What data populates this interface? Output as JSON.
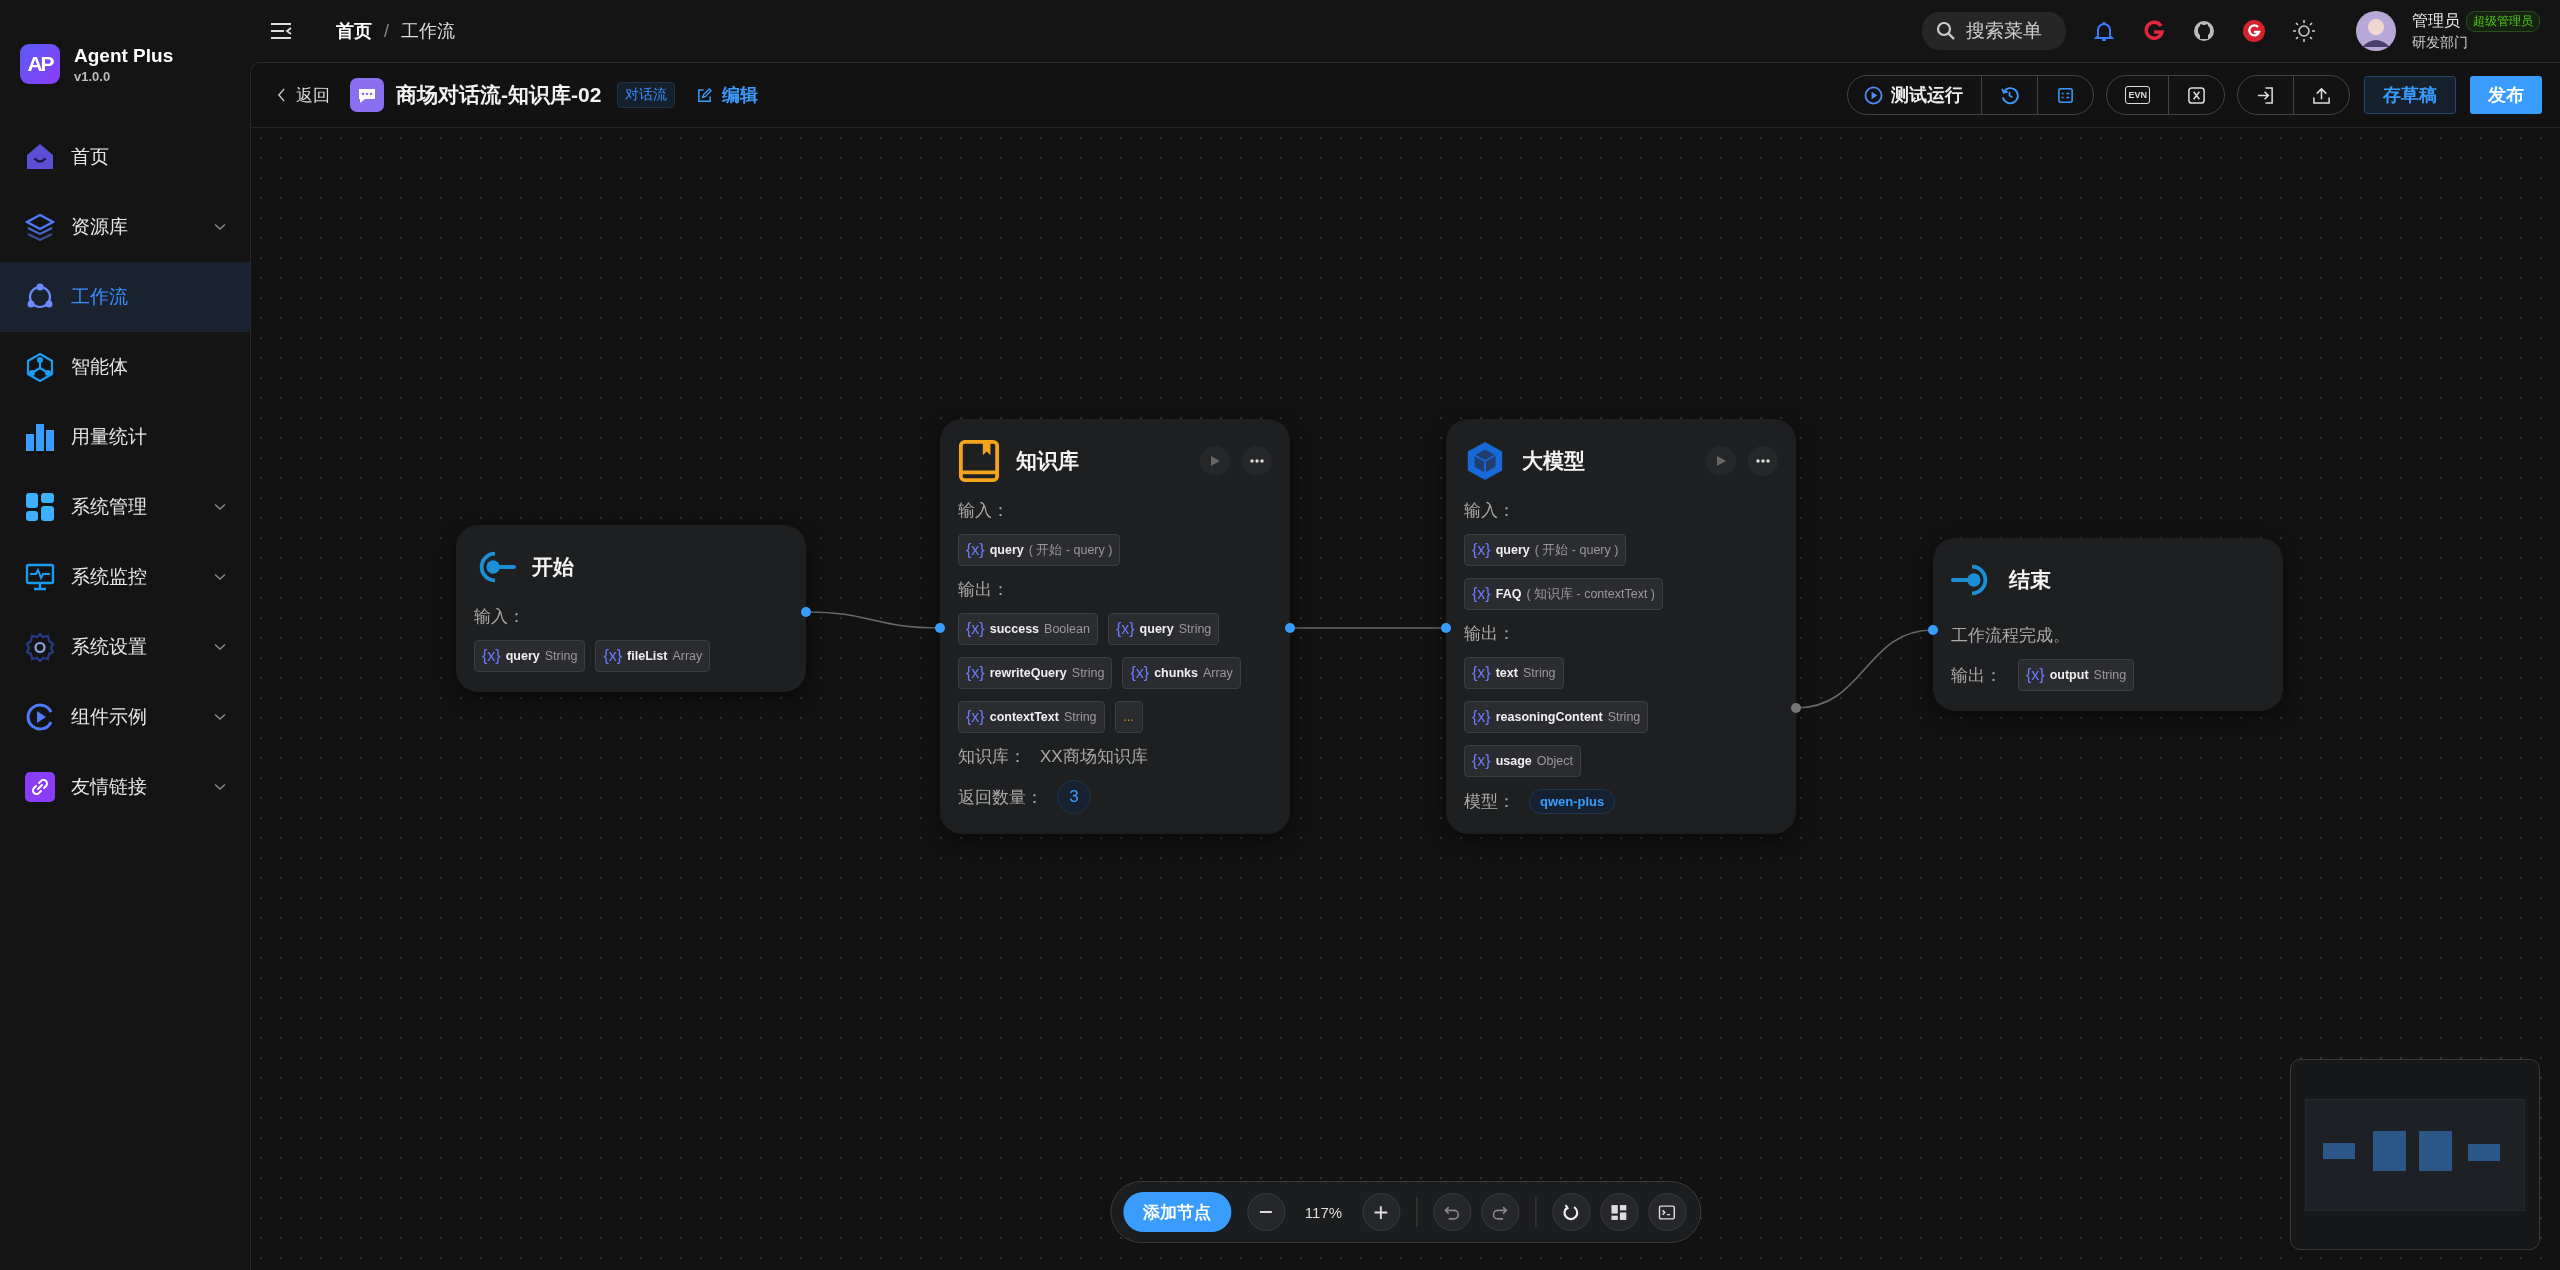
{
  "app": {
    "name": "Agent Plus",
    "version": "v1.0.0",
    "logo": "AP"
  },
  "sidebar": {
    "items": [
      {
        "label": "首页",
        "selected": false,
        "has_submenu": false
      },
      {
        "label": "资源库",
        "selected": false,
        "has_submenu": true
      },
      {
        "label": "工作流",
        "selected": true,
        "has_submenu": false
      },
      {
        "label": "智能体",
        "selected": false,
        "has_submenu": false
      },
      {
        "label": "用量统计",
        "selected": false,
        "has_submenu": false
      },
      {
        "label": "系统管理",
        "selected": false,
        "has_submenu": true
      },
      {
        "label": "系统监控",
        "selected": false,
        "has_submenu": true
      },
      {
        "label": "系统设置",
        "selected": false,
        "has_submenu": true
      },
      {
        "label": "组件示例",
        "selected": false,
        "has_submenu": true
      },
      {
        "label": "友情链接",
        "selected": false,
        "has_submenu": true
      }
    ]
  },
  "header": {
    "breadcrumb": [
      "首页",
      "工作流"
    ],
    "separator": "/",
    "search": {
      "placeholder": "搜索菜单"
    },
    "user": {
      "name": "管理员",
      "role": "超级管理员",
      "department": "研发部门"
    }
  },
  "toolbar": {
    "back": "返回",
    "title": "商场对话流-知识库-02",
    "tag": "对话流",
    "edit": "编辑",
    "run": "测试运行",
    "env": "EVN",
    "save_draft": "存草稿",
    "publish": "发布"
  },
  "nodes": [
    {
      "kind": "start",
      "title": "开始",
      "sections": [
        {
          "kind": "label",
          "text": "输入："
        },
        {
          "kind": "vars_wrap",
          "vars": [
            {
              "icon": "{x}",
              "name": "query",
              "type": "String"
            },
            {
              "icon": "{x}",
              "name": "fileList",
              "type": "Array"
            }
          ]
        }
      ]
    },
    {
      "kind": "knowledge",
      "title": "知识库",
      "sections": [
        {
          "kind": "label",
          "text": "输入："
        },
        {
          "kind": "vars_wrap",
          "vars": [
            {
              "icon": "{x}",
              "name": "query",
              "source": "( 开始 - query )"
            }
          ]
        },
        {
          "kind": "label",
          "text": "输出："
        },
        {
          "kind": "vars_wrap",
          "vars": [
            {
              "icon": "{x}",
              "name": "success",
              "type": "Boolean"
            },
            {
              "icon": "{x}",
              "name": "query",
              "type": "String"
            },
            {
              "icon": "{x}",
              "name": "rewriteQuery",
              "type": "String"
            },
            {
              "icon": "{x}",
              "name": "chunks",
              "type": "Array"
            },
            {
              "icon": "{x}",
              "name": "contextText",
              "type": "String"
            }
          ],
          "more": "..."
        },
        {
          "kind": "field",
          "label": "知识库：",
          "value": "XX商场知识库"
        },
        {
          "kind": "count",
          "label": "返回数量：",
          "value": "3"
        }
      ]
    },
    {
      "kind": "llm",
      "title": "大模型",
      "sections": [
        {
          "kind": "label",
          "text": "输入："
        },
        {
          "kind": "vars_stack",
          "vars": [
            {
              "icon": "{x}",
              "name": "query",
              "source": "( 开始 - query )"
            },
            {
              "icon": "{x}",
              "name": "FAQ",
              "source": "( 知识库 - contextText )"
            }
          ]
        },
        {
          "kind": "label",
          "text": "输出："
        },
        {
          "kind": "vars_stack",
          "vars": [
            {
              "icon": "{x}",
              "name": "text",
              "type": "String"
            },
            {
              "icon": "{x}",
              "name": "reasoningContent",
              "type": "String"
            },
            {
              "icon": "{x}",
              "name": "usage",
              "type": "Object"
            }
          ]
        },
        {
          "kind": "tag",
          "label": "模型：",
          "value": "qwen-plus"
        }
      ]
    },
    {
      "kind": "end",
      "title": "结束",
      "sections": [
        {
          "kind": "text",
          "text": "工作流程完成。"
        },
        {
          "kind": "inline_vars",
          "label": "输出：",
          "vars": [
            {
              "icon": "{x}",
              "name": "output",
              "type": "String"
            }
          ]
        }
      ]
    }
  ],
  "bottom_toolbar": {
    "add_node": "添加节点",
    "zoom": "117%"
  }
}
